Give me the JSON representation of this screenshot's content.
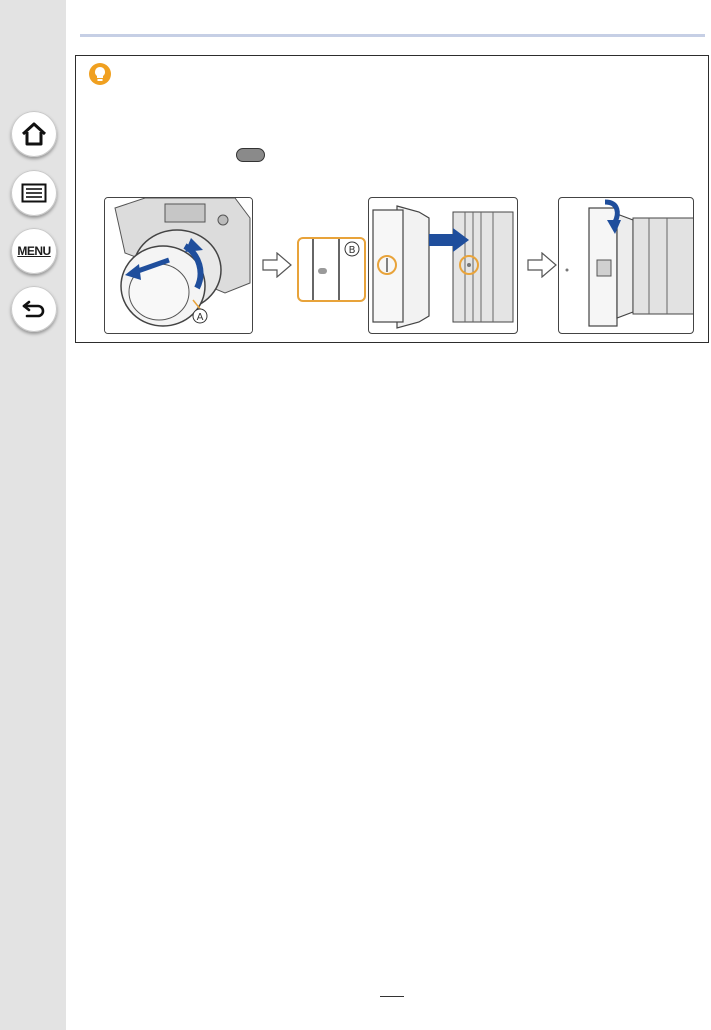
{
  "sidebar": {
    "buttons": [
      {
        "id": "home",
        "icon": "home-icon"
      },
      {
        "id": "contents",
        "icon": "list-icon"
      },
      {
        "id": "menu",
        "label": "MENU"
      },
      {
        "id": "back",
        "icon": "back-arrow-icon"
      }
    ]
  },
  "tip": {
    "icon": "lightbulb-icon",
    "accent_color": "#f0a020"
  },
  "illustration": {
    "callout_a": "A",
    "callout_b": "B",
    "highlight_color": "#e8a33a",
    "arrow_color": "#1f4e9c"
  }
}
